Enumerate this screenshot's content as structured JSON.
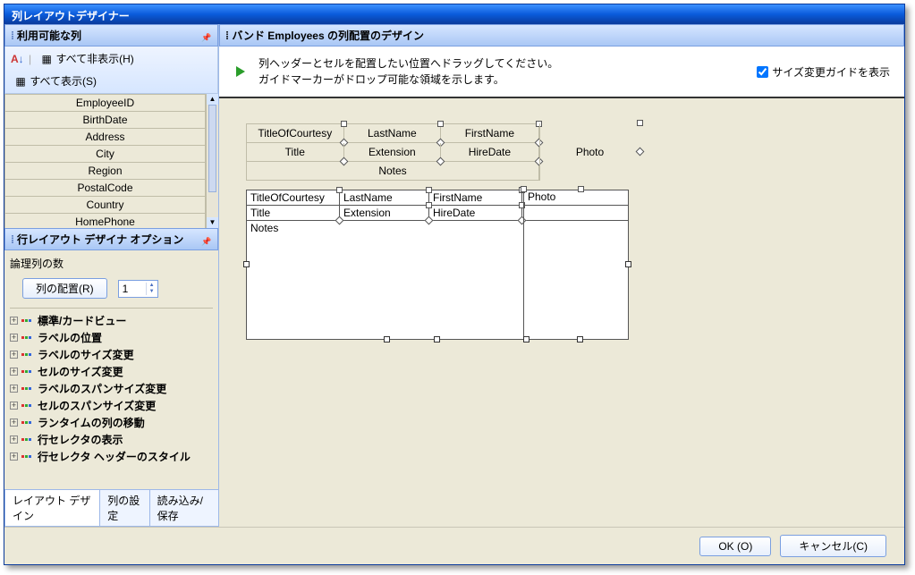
{
  "window": {
    "title": "列レイアウトデザイナー"
  },
  "leftPanel": {
    "availableCols": {
      "title": "利用可能な列"
    },
    "toolbar": {
      "sortIcon": "A↓Z",
      "hideAll": "すべて非表示(H)",
      "showAll": "すべて表示(S)"
    },
    "columns": [
      "EmployeeID",
      "BirthDate",
      "Address",
      "City",
      "Region",
      "PostalCode",
      "Country",
      "HomePhone"
    ],
    "options": {
      "title": "行レイアウト デザイナ オプション",
      "logicalCols": "論理列の数",
      "arrangeBtn": "列の配置(R)",
      "spinValue": "1",
      "tree": [
        "標準/カードビュー",
        "ラベルの位置",
        "ラベルのサイズ変更",
        "セルのサイズ変更",
        "ラベルのスパンサイズ変更",
        "セルのスパンサイズ変更",
        "ランタイムの列の移動",
        "行セレクタの表示",
        "行セレクタ ヘッダーのスタイル"
      ]
    },
    "tabs": [
      "レイアウト デザイン",
      "列の設定",
      "読み込み/保存"
    ]
  },
  "rightPanel": {
    "title": "バンド Employees の列配置のデザイン",
    "hint1": "列ヘッダーとセルを配置したい位置へドラッグしてください。",
    "hint2": "ガイドマーカーがドロップ可能な領域を示します。",
    "checkbox": "サイズ変更ガイドを表示",
    "headerRow1": [
      "TitleOfCourtesy",
      "LastName",
      "FirstName"
    ],
    "headerRow2": [
      "Title",
      "Extension",
      "HireDate"
    ],
    "notes": "Notes",
    "photo": "Photo",
    "cellRow1": [
      "TitleOfCourtesy",
      "LastName",
      "FirstName",
      "Photo"
    ],
    "cellRow2": [
      "Title",
      "Extension",
      "HireDate"
    ],
    "cellRow3": "Notes"
  },
  "footer": {
    "ok": "OK (O)",
    "cancel": "キャンセル(C)"
  }
}
